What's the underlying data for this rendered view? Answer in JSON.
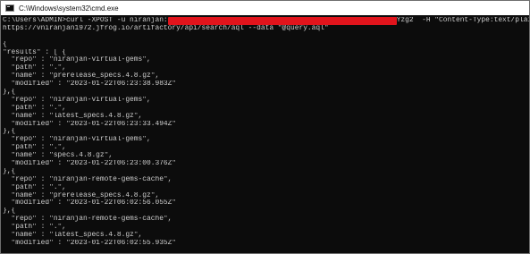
{
  "window": {
    "title": "C:\\Windows\\system32\\cmd.exe",
    "icon": "cmd-icon"
  },
  "console": {
    "command_prefix": "C:\\Users\\ADMIN>curl -XPOST -u niranjan:",
    "command_suffix": "Yzg2  -H \"Content-Type:text/plain\"",
    "command_line2": "https://vniranjan1972.jfrog.io/artifactory/api/search/aql --data \"@query.aql\"",
    "output": [
      "",
      "{",
      "\"results\" : [ {",
      "  \"repo\" : \"niranjan-virtual-gems\",",
      "  \"path\" : \".\",",
      "  \"name\" : \"prerelease_specs.4.8.gz\",",
      "  \"modified\" : \"2023-01-22T06:23:38.983Z\"",
      "},{",
      "  \"repo\" : \"niranjan-virtual-gems\",",
      "  \"path\" : \".\",",
      "  \"name\" : \"latest_specs.4.8.gz\",",
      "  \"modified\" : \"2023-01-22T06:23:33.494Z\"",
      "},{",
      "  \"repo\" : \"niranjan-virtual-gems\",",
      "  \"path\" : \".\",",
      "  \"name\" : \"specs.4.8.gz\",",
      "  \"modified\" : \"2023-01-22T06:23:00.376Z\"",
      "},{",
      "  \"repo\" : \"niranjan-remote-gems-cache\",",
      "  \"path\" : \".\",",
      "  \"name\" : \"prerelease_specs.4.8.gz\",",
      "  \"modified\" : \"2023-01-22T06:02:56.055Z\"",
      "},{",
      "  \"repo\" : \"niranjan-remote-gems-cache\",",
      "  \"path\" : \".\",",
      "  \"name\" : \"latest_specs.4.8.gz\",",
      "  \"modified\" : \"2023-01-22T06:02:55.935Z\""
    ]
  },
  "colors": {
    "console_bg": "#0c0c0c",
    "console_text": "#cccccc",
    "redaction": "#e1141c"
  }
}
